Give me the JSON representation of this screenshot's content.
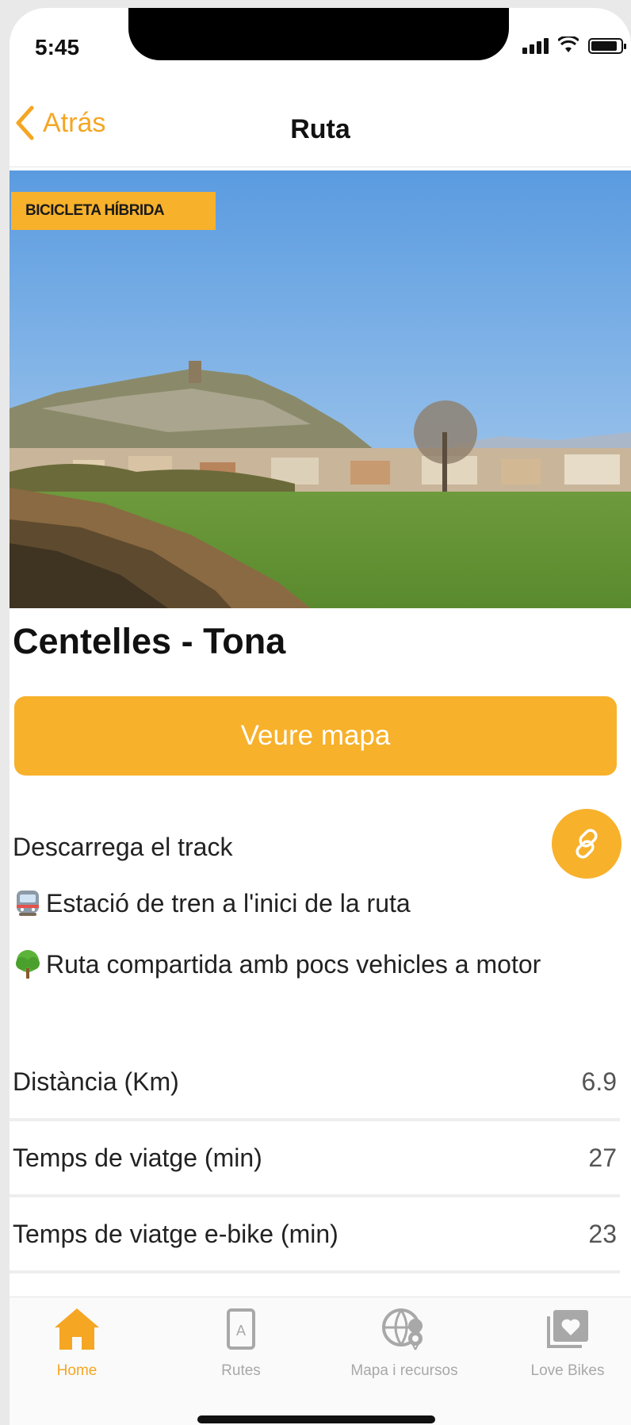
{
  "status_bar": {
    "time": "5:45"
  },
  "nav": {
    "back_label": "Atrás",
    "title": "Ruta"
  },
  "hero": {
    "badge": "BICICLETA HÍBRIDA"
  },
  "route": {
    "title": "Centelles - Tona"
  },
  "actions": {
    "map_button": "Veure mapa",
    "download_label": "Descarrega el track"
  },
  "info": [
    {
      "icon": "train-emoji-icon",
      "text": "Estació de tren a l'inici de la ruta"
    },
    {
      "icon": "tree-emoji-icon",
      "text": "Ruta compartida amb pocs vehicles a motor"
    }
  ],
  "stats": [
    {
      "label": "Distància (Km)",
      "value": "6.9"
    },
    {
      "label": "Temps de viatge (min)",
      "value": "27"
    },
    {
      "label": "Temps de viatge e-bike (min)",
      "value": "23"
    }
  ],
  "tabs": [
    {
      "label": "Home",
      "icon": "home-icon",
      "active": true
    },
    {
      "label": "Rutes",
      "icon": "routes-icon",
      "active": false
    },
    {
      "label": "Mapa i recursos",
      "icon": "globe-pin-icon",
      "active": false
    },
    {
      "label": "Love Bikes",
      "icon": "heart-album-icon",
      "active": false
    }
  ],
  "colors": {
    "accent": "#f7b12b",
    "text": "#111111",
    "inactive": "#a8a8a8"
  }
}
